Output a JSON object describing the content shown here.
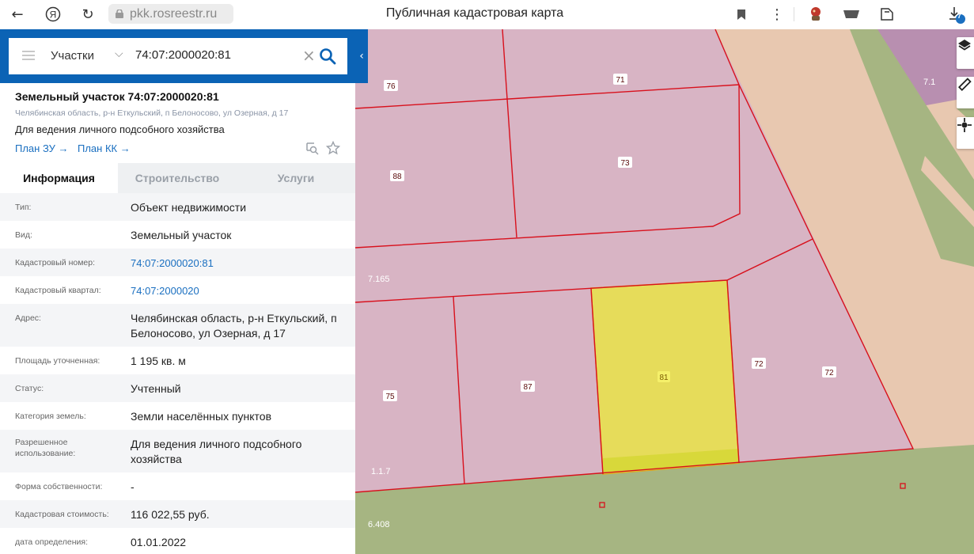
{
  "browser": {
    "url": "pkk.rosreestr.ru",
    "title": "Публичная кадастровая карта",
    "downloads_badge": "7"
  },
  "search": {
    "type_label": "Участки",
    "query": "74:07:2000020:81"
  },
  "object": {
    "title": "Земельный участок 74:07:2000020:81",
    "address": "Челябинская область, р-н Еткульский, п Белоносово, ул Озерная, д 17",
    "use": "Для ведения личного подсобного хозяйства",
    "link_plan_zu": "План ЗУ →",
    "link_plan_kk": "План КК →"
  },
  "tabs": [
    "Информация",
    "Строительство",
    "Услуги"
  ],
  "info": [
    {
      "key": "Тип:",
      "value": "Объект недвижимости"
    },
    {
      "key": "Вид:",
      "value": "Земельный участок"
    },
    {
      "key": "Кадастровый номер:",
      "value": "74:07:2000020:81"
    },
    {
      "key": "Кадастровый квартал:",
      "value": "74:07:2000020"
    },
    {
      "key": "Адрес:",
      "value": "Челябинская область, р-н Еткульский, п Белоносово, ул Озерная, д 17"
    },
    {
      "key": "Площадь уточненная:",
      "value": "1 195 кв. м"
    },
    {
      "key": "Статус:",
      "value": "Учтенный"
    },
    {
      "key": "Категория земель:",
      "value": "Земли населённых пунктов"
    },
    {
      "key": "Разрешенное использование:",
      "value": "Для ведения личного подсобного хозяйства"
    },
    {
      "key": "Форма собственности:",
      "value": "-"
    },
    {
      "key": "Кадастровая стоимость:",
      "value": "116 022,55 руб."
    },
    {
      "key": "дата определения:",
      "value": "01.01.2022"
    }
  ],
  "map": {
    "parcel_labels": [
      "76",
      "71",
      "88",
      "73",
      "72",
      "72",
      "75",
      "87",
      "81"
    ],
    "zone_labels": [
      "7.165",
      "1.1.7",
      "6.408",
      "7.1"
    ],
    "colors": {
      "parcel_fill": "#d8b4c4",
      "selected_fill": "#e6dc5a",
      "border": "#d8101c",
      "residential": "#e8c8b0",
      "green_zone": "#a6b582",
      "purple_zone": "#b88fb0",
      "accent": "#0b63b5"
    }
  }
}
